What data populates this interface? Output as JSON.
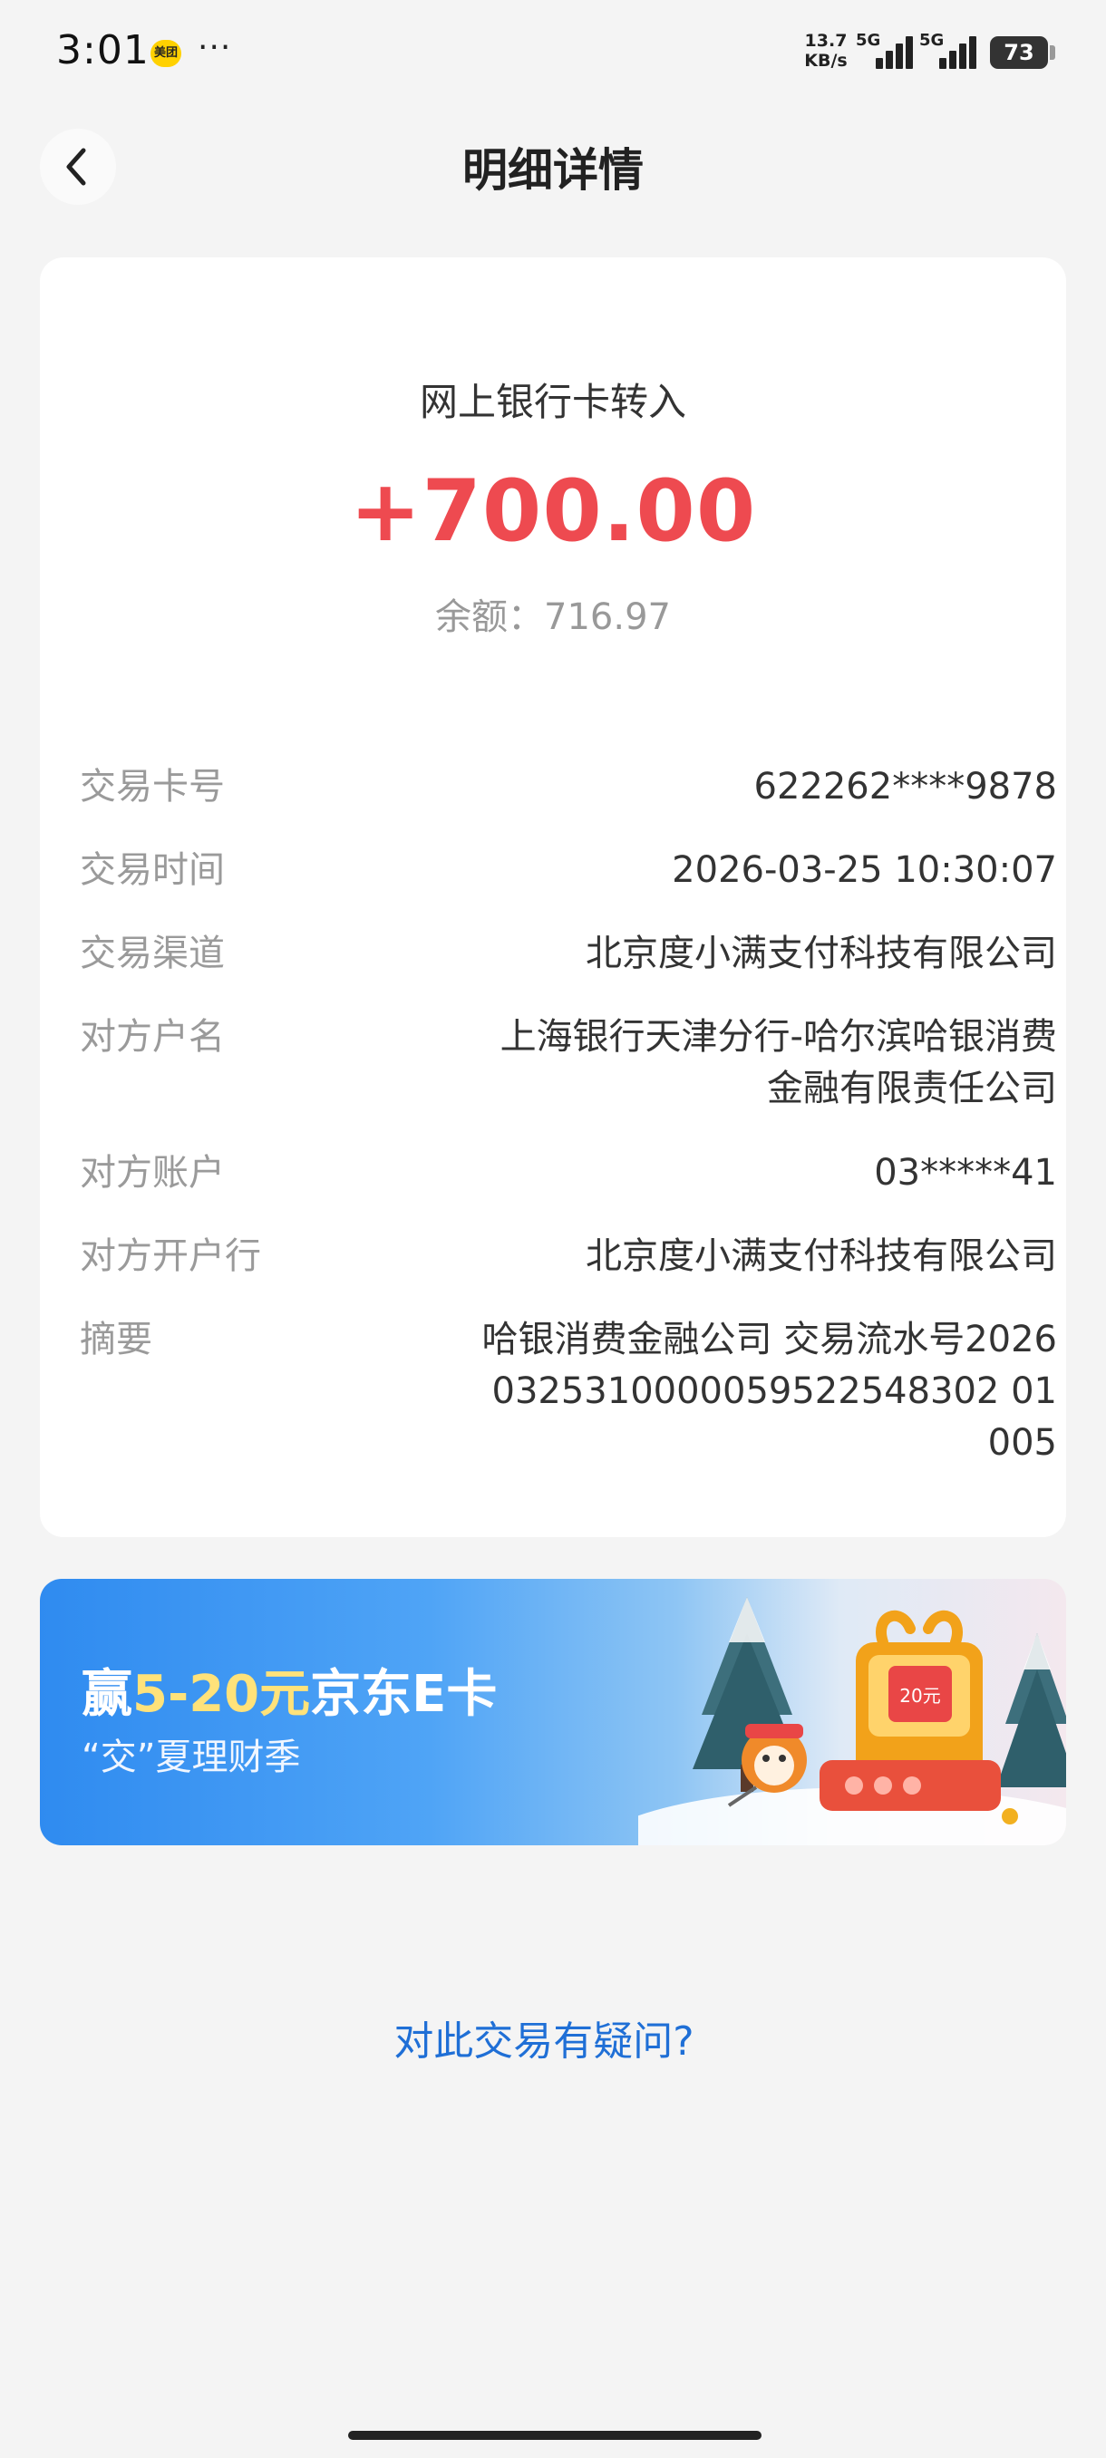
{
  "status_bar": {
    "time": "3:01",
    "app_badge": "美团",
    "more": "···",
    "net_speed_value": "13.7",
    "net_speed_unit": "KB/s",
    "signal_1": "5G",
    "signal_2": "5G",
    "battery": "73"
  },
  "header": {
    "title": "明细详情"
  },
  "transaction": {
    "type": "网上银行卡转入",
    "amount": "+700.00",
    "balance": "余额：716.97",
    "amount_color": "#ee4a50"
  },
  "details": {
    "card_no": {
      "label": "交易卡号",
      "value": "622262****9878"
    },
    "time": {
      "label": "交易时间",
      "value": "2026-03-25 10:30:07"
    },
    "channel": {
      "label": "交易渠道",
      "value": "北京度小满支付科技有限公司"
    },
    "payee_name": {
      "label": "对方户名",
      "value": "上海银行天津分行-哈尔滨哈银消费金融有限责任公司"
    },
    "payee_account": {
      "label": "对方账户",
      "value": "03*****41"
    },
    "payee_bank": {
      "label": "对方开户行",
      "value": "北京度小满支付科技有限公司"
    },
    "memo": {
      "label": "摘要",
      "value": "哈银消费金融公司 交易流水号20260325310000059522548302 01005"
    }
  },
  "banner": {
    "title_prefix": "赢",
    "title_highlight": "5-20元",
    "title_suffix": "京东E卡",
    "subtitle": "“交”夏理财季",
    "art_badge": "20元"
  },
  "question_link": "对此交易有疑问?",
  "icons": {
    "back": "chevron-left-icon"
  },
  "colors": {
    "link": "#1f6fd6",
    "background": "#f4f4f4"
  }
}
